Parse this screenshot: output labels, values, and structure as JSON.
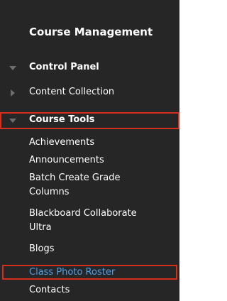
{
  "panel": {
    "title": "Course Management",
    "sections": [
      {
        "label": "Control Panel",
        "state": "expanded",
        "icon": "triangle-down-icon"
      },
      {
        "label": "Content Collection",
        "state": "collapsed",
        "icon": "triangle-right-icon"
      },
      {
        "label": "Course Tools",
        "state": "expanded",
        "icon": "triangle-down-icon",
        "highlighted": true
      }
    ],
    "course_tools_items": [
      "Achievements",
      "Announcements",
      "Batch Create Grade Columns",
      "Blackboard Collaborate Ultra",
      "Blogs",
      "Class Photo Roster",
      "Contacts"
    ],
    "batch_create_line1": "Batch Create Grade",
    "batch_create_line2": "Columns",
    "collaborate_line1": "Blackboard Collaborate",
    "collaborate_line2": "Ultra",
    "selected_item": "Class Photo Roster"
  },
  "colors": {
    "panel_bg": "#262626",
    "highlight_border": "#d42f1e",
    "link_text": "#4ea0e8",
    "arrow_icon": "#6e6e6e"
  }
}
